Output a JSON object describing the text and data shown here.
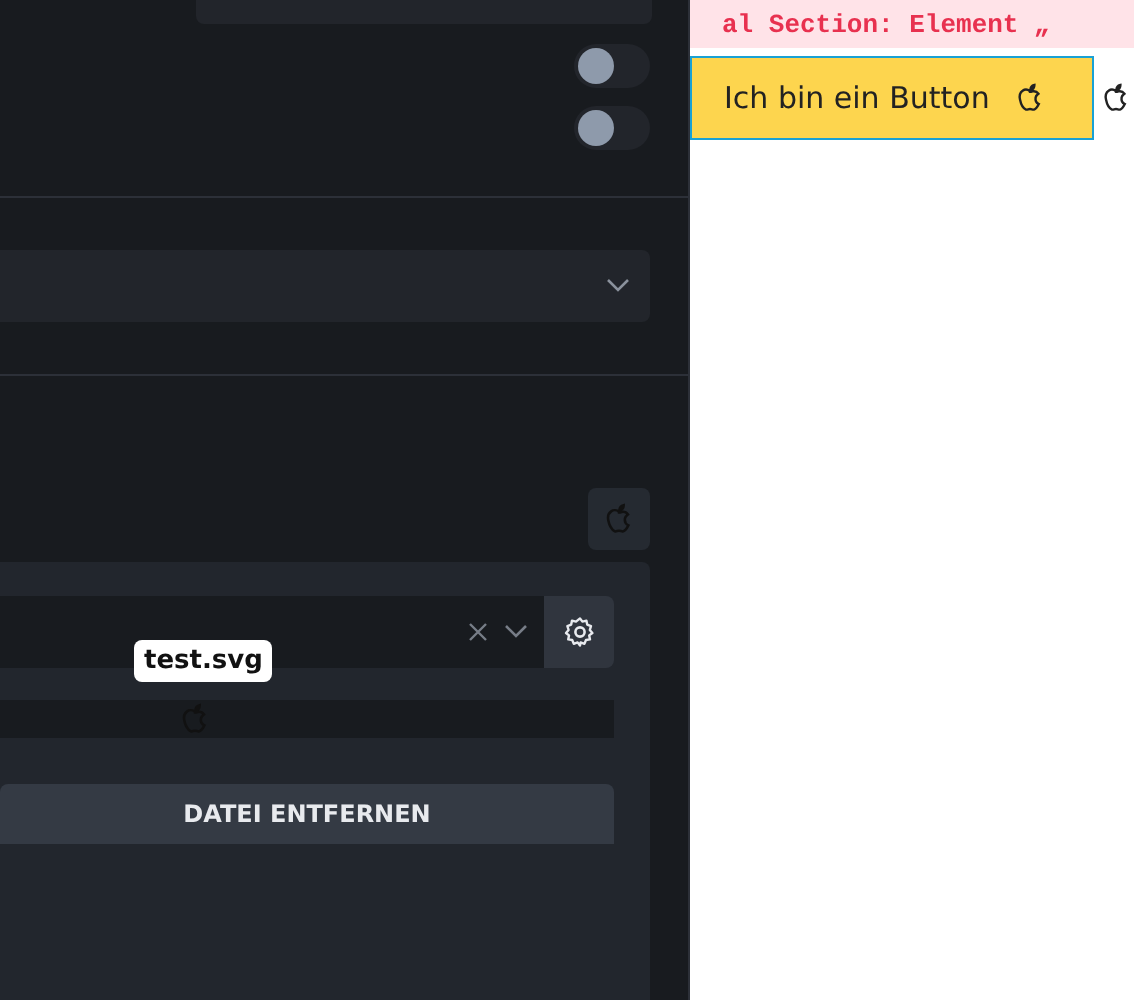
{
  "settings": {
    "toggles": [
      {
        "on": false
      },
      {
        "on": false
      }
    ]
  },
  "file_picker": {
    "tooltip": "test.svg",
    "remove_button": {
      "label": "DATEI ENTFERNEN"
    }
  },
  "code_banner": {
    "text": "al Section: Element „"
  },
  "demo_button": {
    "label": "Ich bin ein Button"
  }
}
